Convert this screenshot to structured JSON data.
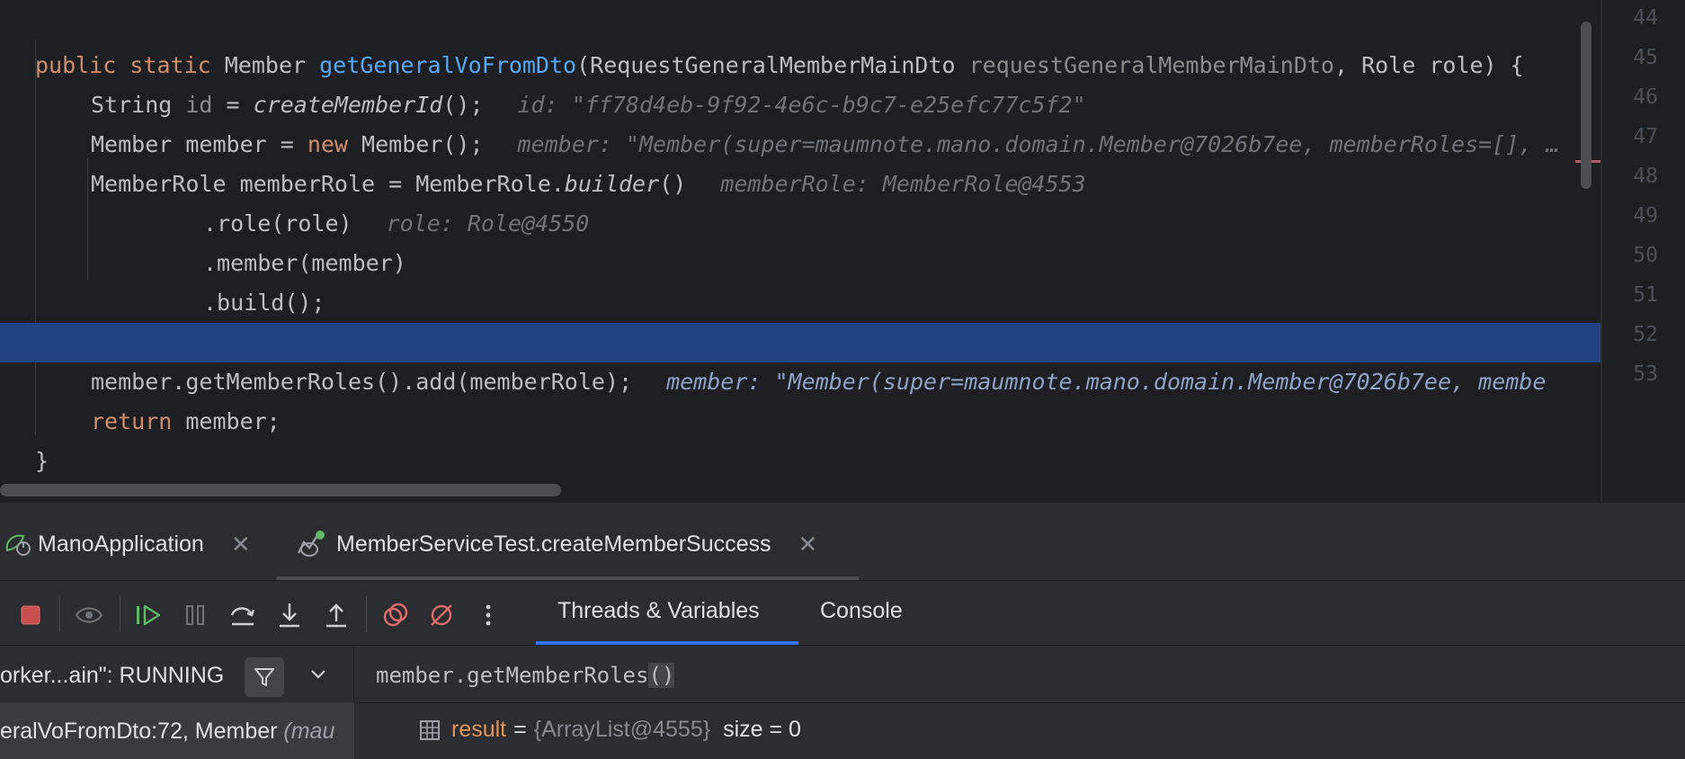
{
  "editor": {
    "line1": {
      "kw": "public static",
      "type": "Member",
      "method": "getGeneralVoFromDto",
      "open": "(RequestGeneralMemberMainDto",
      "param": "requestGeneralMemberMainDto",
      "close": ", Role role) {"
    },
    "line2": {
      "code_a": "String ",
      "var": "id",
      "code_b": " = ",
      "call": "createMemberId",
      "code_c": "();",
      "hint": "id: \"ff78d4eb-9f92-4e6c-b9c7-e25efc77c5f2\""
    },
    "line3": {
      "code_a": "Member member = ",
      "kw": "new",
      "code_b": " Member();",
      "hint": "member: \"Member(super=maumnote.mano.domain.Member@7026b7ee, memberRoles=[], …"
    },
    "line4": {
      "code_a": "MemberRole memberRole = MemberRole.",
      "call": "builder",
      "code_b": "()",
      "hint": "memberRole: MemberRole@4553"
    },
    "line5": {
      "code": ".role(role)",
      "hint": "role: Role@4550"
    },
    "line6": {
      "code": ".member(member)"
    },
    "line7": {
      "code": ".build();"
    },
    "line9": {
      "code": "member.getMemberRoles().add(memberRole);",
      "hint": "member: \"Member(super=maumnote.mano.domain.Member@7026b7ee, membe"
    },
    "line10": {
      "kw": "return",
      "code": " member;"
    },
    "line11": {
      "code": "}"
    }
  },
  "gutter": {
    "line_numbers": [
      "44",
      "45",
      "46",
      "47",
      "48",
      "49",
      "50",
      "51",
      "52",
      "53"
    ]
  },
  "debug": {
    "tabs": [
      {
        "label": "ManoApplication",
        "icon": "spring-boot-icon"
      },
      {
        "label": "MemberServiceTest.createMemberSuccess",
        "icon": "test-debug-icon"
      }
    ],
    "toolbar": {
      "icons": [
        "stop-icon",
        "view-breakpoints-icon",
        "resume-icon",
        "pause-icon",
        "step-over-icon",
        "step-into-icon",
        "step-out-icon",
        "view-breakpoints-red-icon",
        "mute-breakpoints-icon",
        "more-icon"
      ],
      "subtabs": [
        "Threads & Variables",
        "Console"
      ]
    },
    "thread": {
      "label": "orker...ain\": RUNNING"
    },
    "frame": {
      "label": "eralVoFromDto:72, Member ",
      "label_italic": "(mau"
    },
    "evaluate": {
      "expr": "member.getMemberRoles",
      "parens": "()"
    },
    "variable": {
      "name": "result",
      "eq": "=",
      "type": "{ArrayList@4555}",
      "size": "size = 0"
    }
  },
  "colors": {
    "editor_bg": "#1e1f22",
    "tool_bg": "#2b2d30",
    "selection": "#214283",
    "keyword": "#cf8e6d",
    "method": "#56a8f5",
    "accent": "#3574f0"
  }
}
